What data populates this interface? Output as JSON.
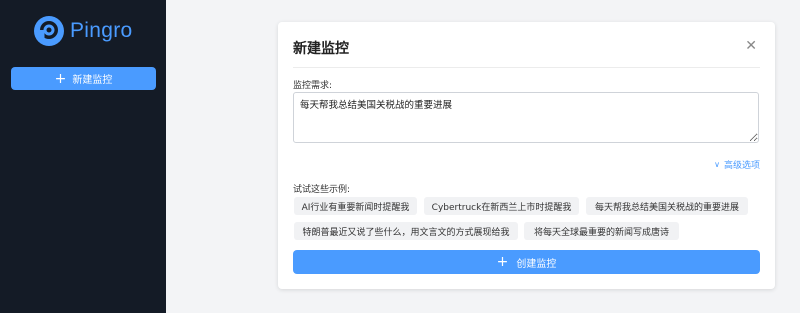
{
  "app": {
    "name": "Pingro",
    "brand_color": "#4a9bff",
    "sidebar_color": "#141b26"
  },
  "sidebar": {
    "new_button_label": "新建监控"
  },
  "dialog": {
    "title": "新建监控",
    "close_icon": "close-icon",
    "field_label": "监控需求:",
    "field_value": "每天帮我总结美国关税战的重要进展",
    "advanced_label": "高级选项",
    "examples_label": "试试这些示例:",
    "examples": [
      "AI行业有重要新闻时提醒我",
      "Cybertruck在新西兰上市时提醒我",
      "每天帮我总结美国关税战的重要进展",
      "特朗普最近又说了些什么，用文言文的方式展现给我",
      "将每天全球最重要的新闻写成唐诗"
    ],
    "create_button_label": "创建监控"
  }
}
